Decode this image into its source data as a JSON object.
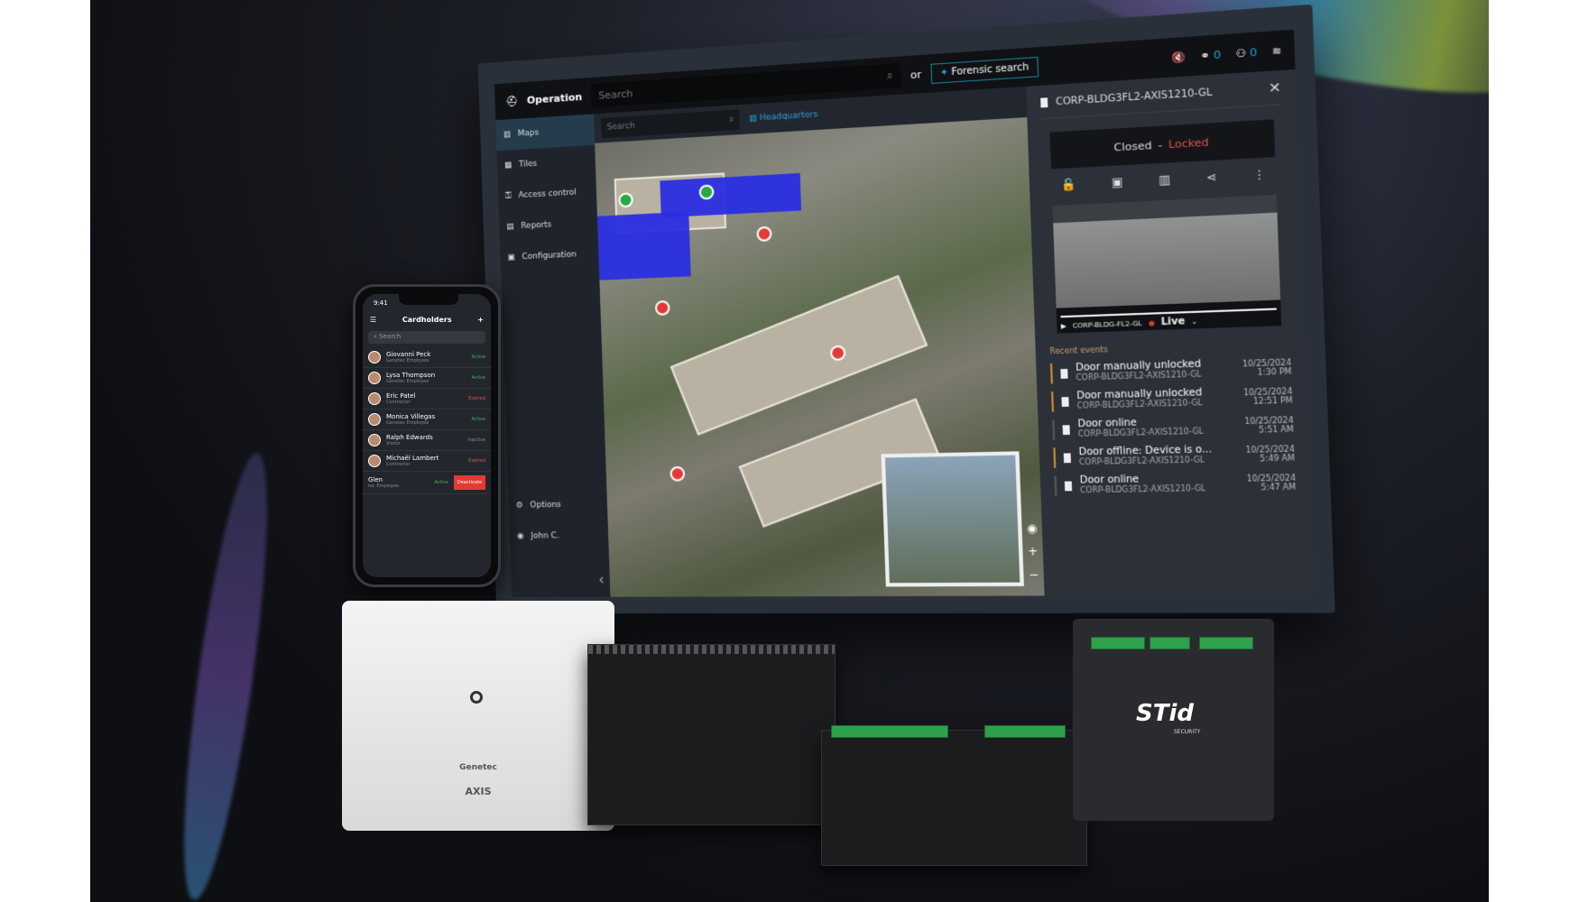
{
  "app": {
    "module": "Operation",
    "search_placeholder": "Search",
    "or": "or",
    "forensic": "Forensic search",
    "counters": [
      "0",
      "0"
    ],
    "sidebar": {
      "items": [
        "Maps",
        "Tiles",
        "Access control",
        "Reports",
        "Configuration"
      ],
      "bottom": [
        "Options",
        "John C."
      ]
    },
    "map": {
      "search_placeholder": "Search",
      "location": "Headquarters"
    },
    "panel": {
      "title": "CORP-BLDG3FL2-AXIS1210-GL",
      "state": "Closed",
      "separator": "-",
      "lock": "Locked",
      "camera": "CORP-BLDG-FL2-GL",
      "live": "Live",
      "recent_label": "Recent events",
      "events": [
        {
          "title": "Door manually unlocked",
          "device": "CORP-BLDG3FL2-AXIS1210-GL",
          "date": "10/25/2024",
          "time": "1:30 PM",
          "color": "#c78a2a"
        },
        {
          "title": "Door manually unlocked",
          "device": "CORP-BLDG3FL2-AXIS1210-GL",
          "date": "10/25/2024",
          "time": "12:51 PM",
          "color": "#c78a2a"
        },
        {
          "title": "Door online",
          "device": "CORP-BLDG3FL2-AXIS1210-GL",
          "date": "10/25/2024",
          "time": "5:51 AM",
          "color": "#555555"
        },
        {
          "title": "Door offline: Device is o...",
          "device": "CORP-BLDG3FL2-AXIS1210-GL",
          "date": "10/25/2024",
          "time": "5:49 AM",
          "color": "#c78a2a"
        },
        {
          "title": "Door online",
          "device": "CORP-BLDG3FL2-AXIS1210-GL",
          "date": "10/25/2024",
          "time": "5:47 AM",
          "color": "#555555"
        }
      ]
    }
  },
  "phone": {
    "time": "9:41",
    "title": "Cardholders",
    "search_placeholder": "Search",
    "rows": [
      {
        "name": "Giovanni Peck",
        "role": "Genetec Employee",
        "status": "Active"
      },
      {
        "name": "Lysa Thompson",
        "role": "Genetec Employee",
        "status": "Active"
      },
      {
        "name": "Eric Patel",
        "role": "Contractor",
        "status": "Expired"
      },
      {
        "name": "Monica Villegas",
        "role": "Genetec Employee",
        "status": "Active"
      },
      {
        "name": "Ralph Edwards",
        "role": "Visitor",
        "status": "Inactive"
      },
      {
        "name": "Michaël Lambert",
        "role": "Contractor",
        "status": "Expired"
      },
      {
        "name": "Glen",
        "role": "tec Employee",
        "status": "Active"
      }
    ],
    "deactivate": "Deactivate"
  },
  "hardware": {
    "box_logos": [
      "Genetec",
      "AXIS"
    ],
    "stid_logo": "STid",
    "stid_sub": "SECURITY"
  },
  "colors": {
    "accent": "#2aa3d8",
    "locked": "#e0524c",
    "active": "#3fb34f",
    "expired": "#d9534f"
  }
}
